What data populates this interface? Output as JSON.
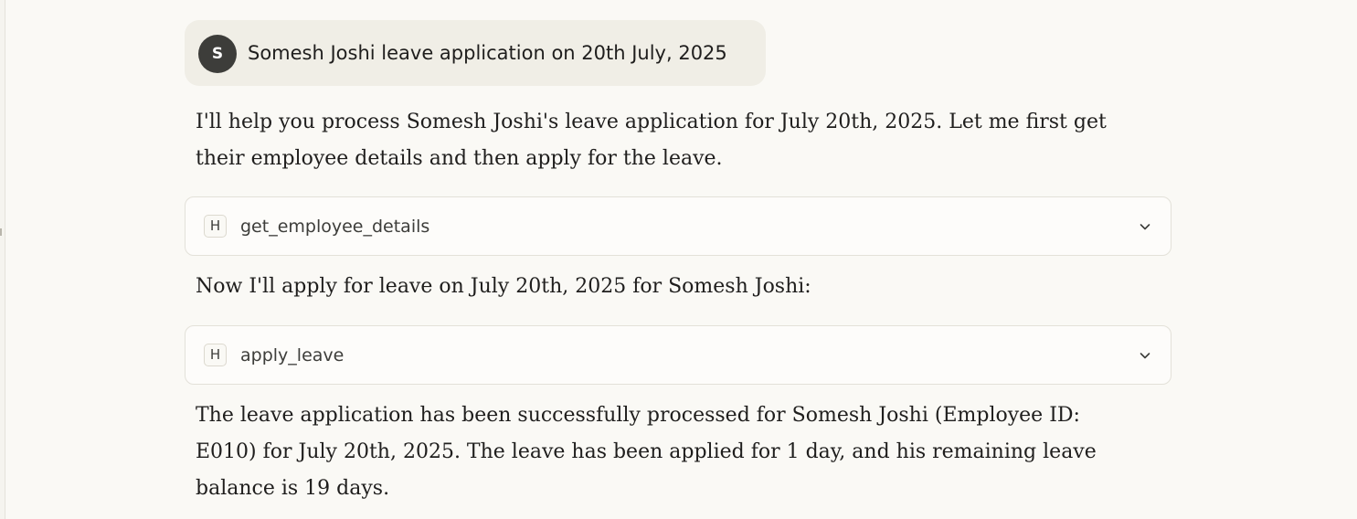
{
  "user_message": {
    "avatar_initial": "S",
    "text": "Somesh Joshi leave application on 20th July, 2025"
  },
  "assistant": {
    "intro_text": "I'll help you process Somesh Joshi's leave application for July 20th, 2025. Let me first get their employee details and then apply for the leave.",
    "tool_calls": [
      {
        "badge": "H",
        "name": "get_employee_details",
        "icon": "chevron-down-icon"
      },
      {
        "badge": "H",
        "name": "apply_leave",
        "icon": "chevron-down-icon"
      }
    ],
    "middle_text": "Now I'll apply for leave on July 20th, 2025 for Somesh Joshi:",
    "result_text": "The leave application has been successfully processed for Somesh Joshi (Employee ID: E010) for July 20th, 2025. The leave has been applied for 1 day, and his remaining leave balance is 19 days."
  },
  "colors": {
    "background": "#faf9f5",
    "user_bubble": "#f0eee6",
    "avatar": "#3d3d3a",
    "tool_card": "#fdfcfa",
    "border": "#e3e1d9"
  }
}
